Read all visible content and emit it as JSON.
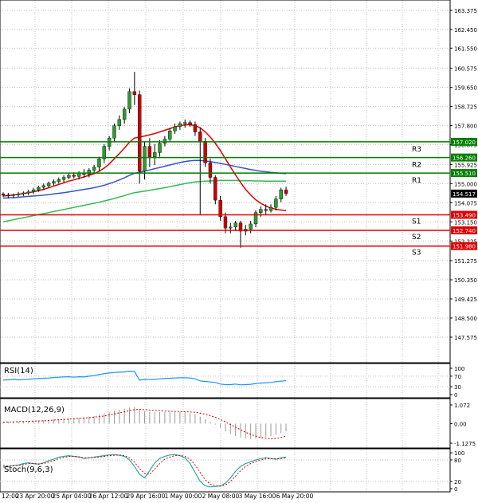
{
  "chart_data": {
    "type": "candlestick",
    "instrument_panels": {
      "main": {
        "price_axis_labels": [
          "163.375",
          "162.450",
          "161.550",
          "160.575",
          "159.650",
          "158.725",
          "157.800",
          "156.875",
          "155.925",
          "155.000",
          "154.075",
          "153.150",
          "152.225",
          "151.275",
          "150.350",
          "149.425",
          "148.500",
          "147.575"
        ],
        "current_price": "154.517",
        "levels": [
          {
            "name": "R3",
            "value": "157.020",
            "kind": "resistance",
            "color": "#008000"
          },
          {
            "name": "R2",
            "value": "156.260",
            "kind": "resistance",
            "color": "#008000"
          },
          {
            "name": "R1",
            "value": "155.510",
            "kind": "resistance",
            "color": "#008000"
          },
          {
            "name": "S1",
            "value": "153.490",
            "kind": "support",
            "color": "#e00000"
          },
          {
            "name": "S2",
            "value": "152.740",
            "kind": "support",
            "color": "#e00000"
          },
          {
            "name": "S3",
            "value": "151.980",
            "kind": "support",
            "color": "#e00000"
          }
        ],
        "candles": [
          [
            154.5,
            154.58,
            154.35,
            154.45
          ],
          [
            154.45,
            154.55,
            154.3,
            154.42
          ],
          [
            154.42,
            154.52,
            154.3,
            154.46
          ],
          [
            154.46,
            154.6,
            154.35,
            154.5
          ],
          [
            154.5,
            154.62,
            154.4,
            154.55
          ],
          [
            154.55,
            154.7,
            154.45,
            154.6
          ],
          [
            154.6,
            154.8,
            154.5,
            154.7
          ],
          [
            154.7,
            154.9,
            154.6,
            154.82
          ],
          [
            154.82,
            155.0,
            154.7,
            154.9
          ],
          [
            154.9,
            155.1,
            154.8,
            155.02
          ],
          [
            155.02,
            155.2,
            154.9,
            155.1
          ],
          [
            155.1,
            155.3,
            155.0,
            155.2
          ],
          [
            155.2,
            155.4,
            155.05,
            155.3
          ],
          [
            155.3,
            155.5,
            155.2,
            155.4
          ],
          [
            155.4,
            155.55,
            155.25,
            155.35
          ],
          [
            155.35,
            155.6,
            155.2,
            155.5
          ],
          [
            155.5,
            155.7,
            155.3,
            155.45
          ],
          [
            155.45,
            155.75,
            155.3,
            155.65
          ],
          [
            155.65,
            155.9,
            155.5,
            155.8
          ],
          [
            155.8,
            156.3,
            155.6,
            156.2
          ],
          [
            156.2,
            156.9,
            156.0,
            156.8
          ],
          [
            156.8,
            157.3,
            156.6,
            157.2
          ],
          [
            157.2,
            157.9,
            157.0,
            157.8
          ],
          [
            157.8,
            158.3,
            157.6,
            158.1
          ],
          [
            158.1,
            158.7,
            157.9,
            158.6
          ],
          [
            158.6,
            159.6,
            158.4,
            159.45
          ],
          [
            159.45,
            160.4,
            158.8,
            159.3
          ],
          [
            159.3,
            159.5,
            155.0,
            155.6
          ],
          [
            155.6,
            157.0,
            155.2,
            156.8
          ],
          [
            156.8,
            157.2,
            155.8,
            156.3
          ],
          [
            156.3,
            156.9,
            155.9,
            156.5
          ],
          [
            156.5,
            157.1,
            156.3,
            156.95
          ],
          [
            156.95,
            157.3,
            156.8,
            157.15
          ],
          [
            157.15,
            157.7,
            157.0,
            157.55
          ],
          [
            157.55,
            157.9,
            157.4,
            157.75
          ],
          [
            157.75,
            158.0,
            157.6,
            157.9
          ],
          [
            157.9,
            158.1,
            157.7,
            157.95
          ],
          [
            157.95,
            158.05,
            157.75,
            157.85
          ],
          [
            157.85,
            158.0,
            157.3,
            157.5
          ],
          [
            157.5,
            157.7,
            153.5,
            157.05
          ],
          [
            157.05,
            157.2,
            155.8,
            156.0
          ],
          [
            156.0,
            156.2,
            155.0,
            155.3
          ],
          [
            155.3,
            155.4,
            154.0,
            154.2
          ],
          [
            154.2,
            154.4,
            153.2,
            153.4
          ],
          [
            153.4,
            153.6,
            152.6,
            152.85
          ],
          [
            152.85,
            153.1,
            152.6,
            152.9
          ],
          [
            152.9,
            153.2,
            152.7,
            153.1
          ],
          [
            153.1,
            153.2,
            151.9,
            152.7
          ],
          [
            152.7,
            153.0,
            152.5,
            152.8
          ],
          [
            152.8,
            153.2,
            152.6,
            153.05
          ],
          [
            153.05,
            153.7,
            152.9,
            153.6
          ],
          [
            153.6,
            153.9,
            153.4,
            153.75
          ],
          [
            153.75,
            154.0,
            153.5,
            153.7
          ],
          [
            153.7,
            154.0,
            153.6,
            153.85
          ],
          [
            153.85,
            154.4,
            153.7,
            154.25
          ],
          [
            154.25,
            154.8,
            154.1,
            154.7
          ],
          [
            154.7,
            154.85,
            154.4,
            154.52
          ]
        ],
        "ma_short": [
          154.4,
          154.42,
          154.45,
          154.48,
          154.52,
          154.56,
          154.6,
          154.66,
          154.72,
          154.8,
          154.88,
          154.96,
          155.04,
          155.12,
          155.18,
          155.25,
          155.32,
          155.4,
          155.48,
          155.6,
          155.75,
          155.95,
          156.2,
          156.45,
          156.72,
          157.0,
          157.2,
          157.25,
          157.3,
          157.36,
          157.42,
          157.5,
          157.58,
          157.66,
          157.74,
          157.8,
          157.84,
          157.85,
          157.8,
          157.7,
          157.5,
          157.25,
          156.95,
          156.6,
          156.2,
          155.8,
          155.42,
          155.05,
          154.72,
          154.45,
          154.22,
          154.05,
          153.92,
          153.82,
          153.76,
          153.72,
          153.7
        ],
        "ma_mid": [
          154.3,
          154.31,
          154.32,
          154.34,
          154.36,
          154.38,
          154.4,
          154.42,
          154.44,
          154.47,
          154.5,
          154.53,
          154.56,
          154.6,
          154.64,
          154.68,
          154.72,
          154.76,
          154.8,
          154.86,
          154.92,
          155.0,
          155.08,
          155.18,
          155.28,
          155.4,
          155.5,
          155.55,
          155.6,
          155.66,
          155.72,
          155.78,
          155.84,
          155.9,
          155.96,
          156.02,
          156.07,
          156.1,
          156.12,
          156.12,
          156.1,
          156.06,
          156.02,
          155.98,
          155.93,
          155.88,
          155.83,
          155.78,
          155.73,
          155.68,
          155.64,
          155.6,
          155.57,
          155.54,
          155.52,
          155.5,
          155.48
        ],
        "ma_long": [
          153.15,
          153.2,
          153.25,
          153.3,
          153.35,
          153.4,
          153.45,
          153.5,
          153.55,
          153.6,
          153.65,
          153.7,
          153.75,
          153.8,
          153.85,
          153.9,
          153.95,
          154.0,
          154.05,
          154.1,
          154.16,
          154.22,
          154.28,
          154.35,
          154.42,
          154.5,
          154.56,
          154.6,
          154.64,
          154.68,
          154.72,
          154.76,
          154.8,
          154.85,
          154.9,
          154.95,
          155.0,
          155.04,
          155.08,
          155.1,
          155.12,
          155.13,
          155.14,
          155.15,
          155.15,
          155.15,
          155.15,
          155.14,
          155.14,
          155.14,
          155.13,
          155.13,
          155.12,
          155.12,
          155.12,
          155.12,
          155.12
        ]
      },
      "rsi": {
        "label": "RSI(14)",
        "axis_labels": [
          "100",
          "70",
          "30",
          "0"
        ],
        "values": [
          55,
          56,
          58,
          56,
          57,
          58,
          60,
          61,
          62,
          63,
          65,
          66,
          67,
          68,
          66,
          68,
          67,
          70,
          72,
          76,
          80,
          82,
          84,
          85,
          86,
          89,
          88,
          55,
          58,
          57,
          58,
          60,
          61,
          62,
          63,
          64,
          64,
          63,
          60,
          52,
          50,
          48,
          46,
          40,
          38,
          38,
          40,
          37,
          38,
          39,
          42,
          44,
          45,
          46,
          49,
          51,
          53
        ]
      },
      "macd": {
        "label": "MACD(12,26,9)",
        "axis_labels": [
          "1.072",
          "0.00",
          "-1.1275"
        ],
        "histogram": [
          0.1,
          0.11,
          0.12,
          0.13,
          0.14,
          0.15,
          0.16,
          0.18,
          0.2,
          0.22,
          0.24,
          0.26,
          0.28,
          0.3,
          0.32,
          0.34,
          0.36,
          0.4,
          0.44,
          0.5,
          0.58,
          0.66,
          0.74,
          0.8,
          0.86,
          0.92,
          0.95,
          0.8,
          0.72,
          0.68,
          0.66,
          0.66,
          0.66,
          0.66,
          0.66,
          0.66,
          0.64,
          0.6,
          0.55,
          0.4,
          0.25,
          0.1,
          -0.05,
          -0.25,
          -0.45,
          -0.6,
          -0.72,
          -0.8,
          -0.86,
          -0.88,
          -0.86,
          -0.82,
          -0.78,
          -0.72,
          -0.64,
          -0.55,
          -0.45
        ],
        "signal": [
          0.08,
          0.09,
          0.1,
          0.11,
          0.12,
          0.13,
          0.14,
          0.15,
          0.16,
          0.18,
          0.2,
          0.22,
          0.24,
          0.26,
          0.28,
          0.3,
          0.32,
          0.34,
          0.37,
          0.4,
          0.44,
          0.5,
          0.56,
          0.62,
          0.68,
          0.74,
          0.8,
          0.82,
          0.8,
          0.78,
          0.76,
          0.74,
          0.72,
          0.71,
          0.7,
          0.69,
          0.68,
          0.67,
          0.65,
          0.6,
          0.54,
          0.46,
          0.36,
          0.24,
          0.1,
          -0.05,
          -0.2,
          -0.35,
          -0.5,
          -0.62,
          -0.72,
          -0.8,
          -0.85,
          -0.88,
          -0.86,
          -0.8,
          -0.72
        ]
      },
      "stoch": {
        "label": "Stoch(9,6,3)",
        "axis_labels": [
          "100",
          "80",
          "20",
          "0"
        ],
        "main": [
          60,
          62,
          65,
          66,
          70,
          72,
          70,
          68,
          72,
          78,
          82,
          88,
          90,
          92,
          90,
          88,
          84,
          86,
          88,
          90,
          92,
          94,
          95,
          93,
          90,
          80,
          62,
          40,
          30,
          50,
          72,
          84,
          90,
          94,
          95,
          92,
          86,
          70,
          45,
          20,
          8,
          5,
          6,
          8,
          15,
          30,
          48,
          62,
          70,
          75,
          80,
          84,
          86,
          84,
          82,
          86,
          88
        ],
        "signal": [
          65,
          63,
          64,
          65,
          67,
          70,
          70,
          69,
          70,
          74,
          78,
          84,
          87,
          90,
          90,
          89,
          86,
          86,
          87,
          88,
          90,
          92,
          93,
          94,
          92,
          86,
          74,
          56,
          42,
          40,
          55,
          70,
          82,
          88,
          92,
          93,
          90,
          82,
          66,
          45,
          25,
          12,
          8,
          7,
          10,
          20,
          35,
          50,
          62,
          70,
          76,
          80,
          83,
          84,
          83,
          84,
          86
        ]
      }
    },
    "time_axis_labels": [
      "12:00",
      "23 Apr 20:00",
      "25 Apr 04:00",
      "26 Apr 12:00",
      "29 Apr 16:00",
      "1 May 00:00",
      "2 May 08:00",
      "3 May 16:00",
      "6 May 20:00"
    ],
    "colors": {
      "bull": "#2e9c2e",
      "bear": "#cc0000",
      "ma_short": "#e00000",
      "ma_mid": "#3355cc",
      "ma_long": "#33bb55",
      "indicator_line": "#1e90ff",
      "grid": "#c0c0c0"
    }
  }
}
